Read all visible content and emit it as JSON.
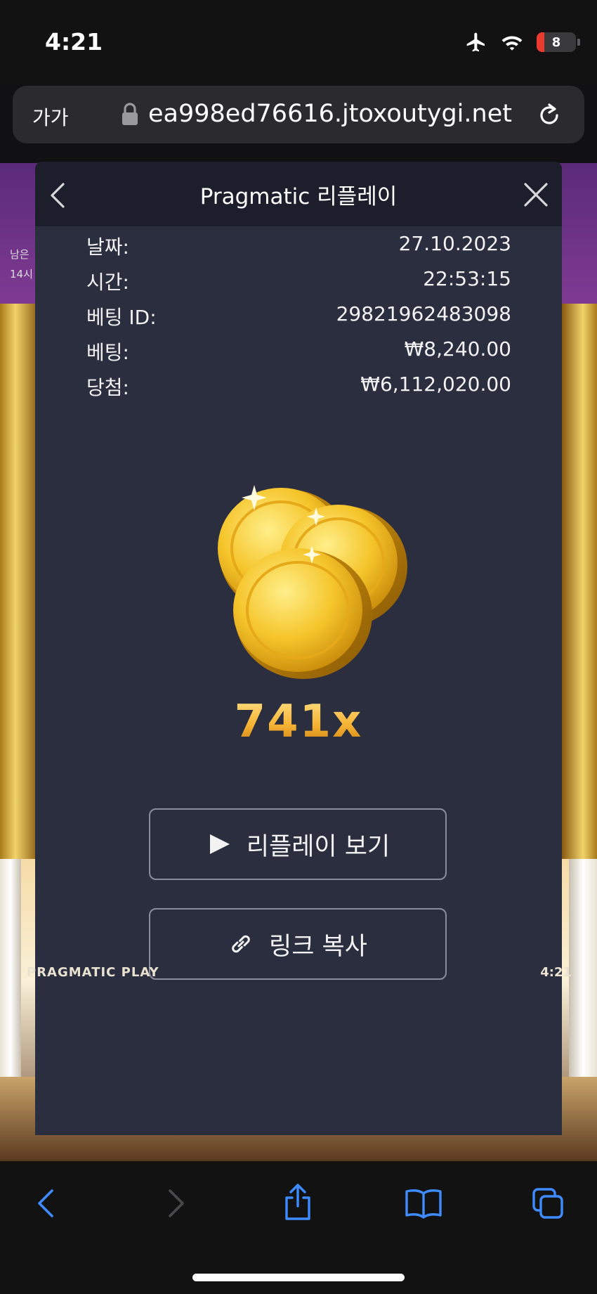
{
  "status_bar": {
    "time": "4:21",
    "battery_level": "8",
    "icons": [
      "airplane-icon",
      "wifi-icon",
      "battery-icon"
    ]
  },
  "browser": {
    "text_size_button": "가가",
    "url": "ea998ed76616.jtoxoutygi.net",
    "icons": [
      "lock-icon",
      "reload-icon"
    ]
  },
  "game": {
    "brand": "PRAGMATIC PLAY",
    "clock": "4:21",
    "side_text_1": "남은",
    "side_text_2": "14시"
  },
  "modal": {
    "title": "Pragmatic 리플레이",
    "fields": [
      {
        "label": "날짜:",
        "value": "27.10.2023"
      },
      {
        "label": "시간:",
        "value": "22:53:15"
      },
      {
        "label": "베팅 ID:",
        "value": "29821962483098"
      },
      {
        "label": "베팅:",
        "value": "₩8,240.00"
      },
      {
        "label": "당첨:",
        "value": "₩6,112,020.00"
      }
    ],
    "multiplier": "741x",
    "watch_replay_label": "리플레이 보기",
    "copy_link_label": "링크 복사",
    "icons": [
      "chevron-left-icon",
      "close-icon",
      "coins-icon",
      "play-icon",
      "link-icon"
    ]
  },
  "toolbar": {
    "icons": [
      "back-icon",
      "forward-icon",
      "share-icon",
      "bookmarks-icon",
      "tabs-icon"
    ]
  },
  "colors": {
    "modal_background": "#2b2e3f",
    "modal_header": "#1d1e2b",
    "multiplier_gold": "#f0b33a",
    "toolbar_blue": "#3f8cff"
  }
}
